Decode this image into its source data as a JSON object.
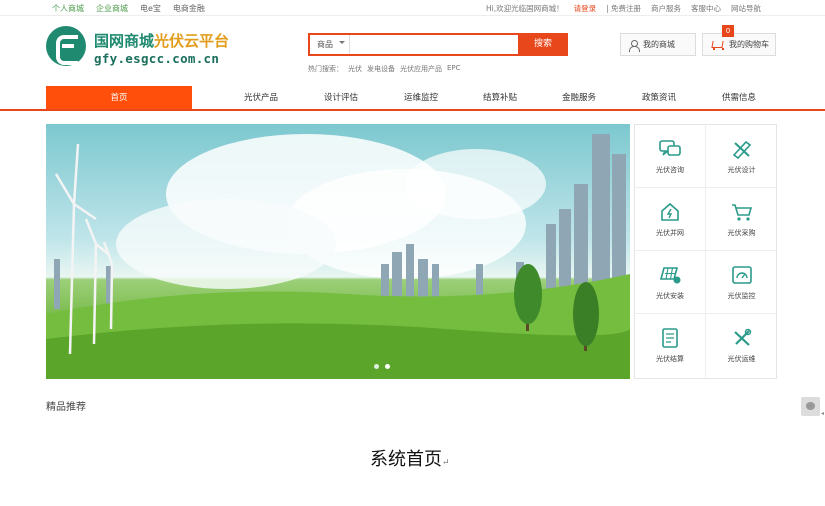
{
  "topbar": {
    "left": [
      {
        "label": "个人商城",
        "active": true
      },
      {
        "label": "企业商城",
        "active": true
      },
      {
        "label": "电e宝",
        "active": false
      },
      {
        "label": "电商金融",
        "active": false
      }
    ],
    "welcome": "Hi,欢迎光临国网商城！",
    "login": "请登录",
    "register": "| 免费注册",
    "merchant": "商户服务",
    "service": "客服中心",
    "sitemap": "网站导航"
  },
  "logo": {
    "name_main": "国网商城",
    "name_accent": "光伏云平台",
    "url": "gfy.esgcc.com.cn"
  },
  "search": {
    "category": "商品",
    "placeholder": "",
    "button": "搜索"
  },
  "hot": {
    "label": "热门搜索：",
    "terms": [
      "光伏",
      "发电设备",
      "光伏应用产品",
      "EPC"
    ]
  },
  "header_buttons": {
    "my_store": "我的商城",
    "cart": "我的购物车",
    "cart_count": "0"
  },
  "nav": [
    {
      "label": "首页",
      "active": true
    },
    {
      "label": "光伏产品"
    },
    {
      "label": "设计评估"
    },
    {
      "label": "运维监控"
    },
    {
      "label": "结算补贴"
    },
    {
      "label": "金融服务"
    },
    {
      "label": "政策资讯"
    },
    {
      "label": "供需信息"
    }
  ],
  "services": [
    {
      "label": "光伏咨询",
      "icon": "chat-icon"
    },
    {
      "label": "光伏设计",
      "icon": "design-tools-icon"
    },
    {
      "label": "光伏并网",
      "icon": "grid-home-icon"
    },
    {
      "label": "光伏采购",
      "icon": "shopping-cart-icon"
    },
    {
      "label": "光伏安装",
      "icon": "solar-panel-icon"
    },
    {
      "label": "光伏监控",
      "icon": "monitor-gauge-icon"
    },
    {
      "label": "光伏结算",
      "icon": "invoice-icon"
    },
    {
      "label": "光伏运维",
      "icon": "wrench-icon"
    }
  ],
  "colors": {
    "accent": "#e8461b",
    "brand_green": "#1f8a70",
    "brand_gold": "#e29d1c",
    "icon_teal": "#2a9a8a"
  },
  "section_title": "精品推荐",
  "caption": "系统首页",
  "caption_mark": "↵"
}
